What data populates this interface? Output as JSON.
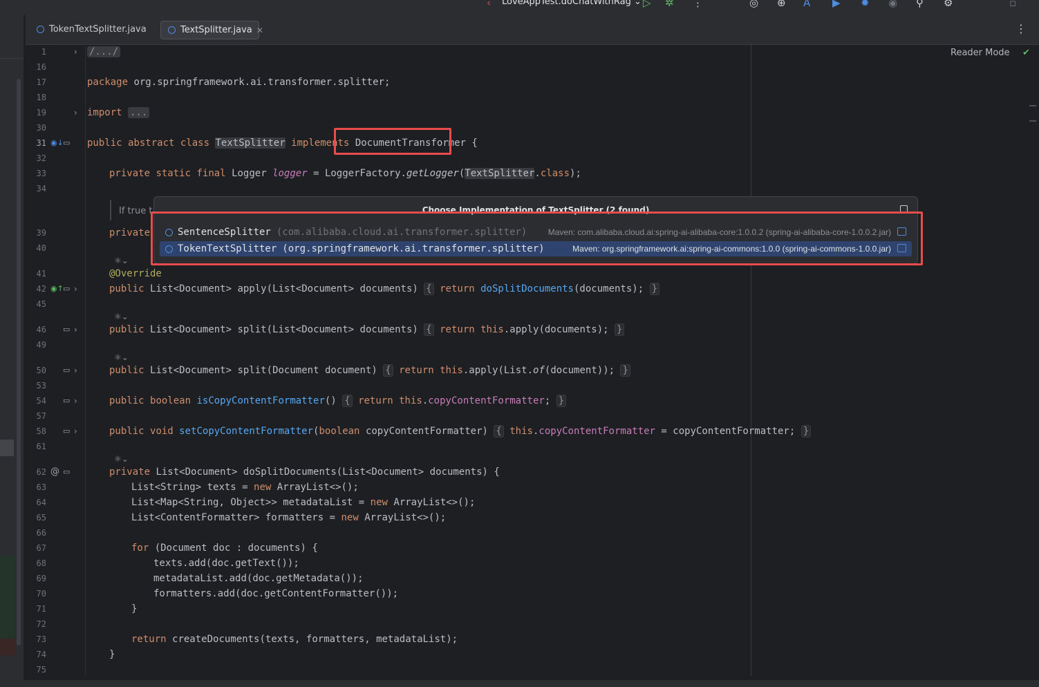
{
  "toolbar": {
    "run_config": "LoveAppTest.doChatWithRag"
  },
  "tabs": [
    {
      "label": "TokenTextSplitter.java",
      "active": false
    },
    {
      "label": "TextSplitter.java",
      "active": true
    }
  ],
  "editor": {
    "reader_mode": "Reader Mode",
    "doc_hint": "If true t"
  },
  "popup": {
    "title": "Choose Implementation of TextSplitter (2 found)",
    "items": [
      {
        "name": "SentenceSplitter",
        "package": "(com.alibaba.cloud.ai.transformer.splitter)",
        "maven": "Maven: com.alibaba.cloud.ai:spring-ai-alibaba-core:1.0.0.2 (spring-ai-alibaba-core-1.0.0.2.jar)",
        "selected": false
      },
      {
        "name": "TokenTextSplitter",
        "package": "(org.springframework.ai.transformer.splitter)",
        "maven": "Maven: org.springframework.ai:spring-ai-commons:1.0.0 (spring-ai-commons-1.0.0.jar)",
        "selected": true
      }
    ]
  },
  "code_lines": [
    {
      "n": "1",
      "t": "/.../"
    },
    {
      "n": "16",
      "t": ""
    },
    {
      "n": "17",
      "t": "package org.springframework.ai.transformer.splitter;"
    },
    {
      "n": "18",
      "t": ""
    },
    {
      "n": "19",
      "t": "import ..."
    },
    {
      "n": "30",
      "t": ""
    },
    {
      "n": "31",
      "t": "public abstract class TextSplitter implements DocumentTransformer {"
    },
    {
      "n": "32",
      "t": ""
    },
    {
      "n": "33",
      "t": "private static final Logger logger = LoggerFactory.getLogger(TextSplitter.class);"
    },
    {
      "n": "34",
      "t": ""
    },
    {
      "n": "39",
      "t": "private"
    },
    {
      "n": "40",
      "t": ""
    },
    {
      "n": "41",
      "t": "@Override"
    },
    {
      "n": "42",
      "t": "public List<Document> apply(List<Document> documents) { return doSplitDocuments(documents); }"
    },
    {
      "n": "45",
      "t": ""
    },
    {
      "n": "46",
      "t": "public List<Document> split(List<Document> documents) { return this.apply(documents); }"
    },
    {
      "n": "49",
      "t": ""
    },
    {
      "n": "50",
      "t": "public List<Document> split(Document document) { return this.apply(List.of(document)); }"
    },
    {
      "n": "53",
      "t": ""
    },
    {
      "n": "54",
      "t": "public boolean isCopyContentFormatter() { return this.copyContentFormatter; }"
    },
    {
      "n": "57",
      "t": ""
    },
    {
      "n": "58",
      "t": "public void setCopyContentFormatter(boolean copyContentFormatter) { this.copyContentFormatter = copyContentFormatter; }"
    },
    {
      "n": "61",
      "t": ""
    },
    {
      "n": "62",
      "t": "private List<Document> doSplitDocuments(List<Document> documents) {"
    },
    {
      "n": "63",
      "t": "List<String> texts = new ArrayList<>();"
    },
    {
      "n": "64",
      "t": "List<Map<String, Object>> metadataList = new ArrayList<>();"
    },
    {
      "n": "65",
      "t": "List<ContentFormatter> formatters = new ArrayList<>();"
    },
    {
      "n": "66",
      "t": ""
    },
    {
      "n": "67",
      "t": "for (Document doc : documents) {"
    },
    {
      "n": "68",
      "t": "texts.add(doc.getText());"
    },
    {
      "n": "69",
      "t": "metadataList.add(doc.getMetadata());"
    },
    {
      "n": "70",
      "t": "formatters.add(doc.getContentFormatter());"
    },
    {
      "n": "71",
      "t": "}"
    },
    {
      "n": "72",
      "t": ""
    },
    {
      "n": "73",
      "t": "return createDocuments(texts, formatters, metadataList);"
    },
    {
      "n": "74",
      "t": "}"
    },
    {
      "n": "75",
      "t": ""
    }
  ]
}
